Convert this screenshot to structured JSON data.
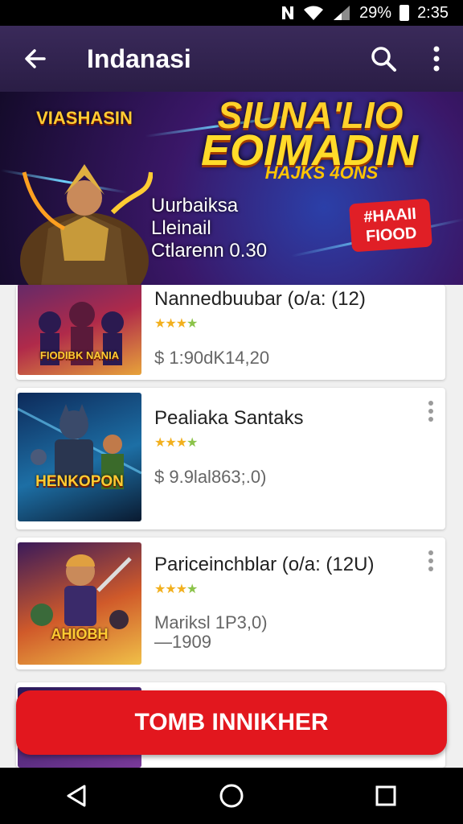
{
  "status_bar": {
    "battery": "29%",
    "time": "2:35",
    "icons": [
      "nfc-icon",
      "wifi-icon",
      "signal-icon",
      "battery-icon"
    ]
  },
  "app_bar": {
    "title": "Indanasi",
    "icons": [
      "back-arrow-icon",
      "search-icon",
      "more-vertical-icon"
    ]
  },
  "banner": {
    "logo_text": "VIASHASIN",
    "headline_1": "SIUNA'LIO",
    "headline_2": "EOIMADIN",
    "subheadline": "HAJKS 4ONS",
    "lines": [
      "Uurbaiksa",
      "Lleinail",
      "Ctlarenn 0.30"
    ],
    "badge": "#HAAII FIOOD"
  },
  "games": [
    {
      "name": "Nannedbuubar (o/a: (12)",
      "rating": 4,
      "price": "$ 1:90dK14,20",
      "thumb_label": "FIODIBK NANIA",
      "thumb_colors": [
        "#3a2a7a",
        "#b02a4a",
        "#e7a33a"
      ]
    },
    {
      "name": "Pealiaka Santaks",
      "rating": 4,
      "price": "$ 9.9lal863;.0)",
      "thumb_label": "HENKOPON",
      "thumb_colors": [
        "#0d2a5a",
        "#1d6fa5",
        "#f0b84a"
      ]
    },
    {
      "name": "Pariceinchblar (o/a: (12U)",
      "rating": 4,
      "price": "Mariksl 1P3,0)\n—1909",
      "thumb_label": "AHIOBH",
      "thumb_colors": [
        "#3a1a5a",
        "#d05a2a",
        "#f0c048"
      ]
    }
  ],
  "cta": {
    "label": "TOMB INNIKHER"
  },
  "nav_bar": {
    "icons": [
      "back-triangle-icon",
      "home-circle-icon",
      "recents-square-icon"
    ]
  },
  "colors": {
    "app_bar": "#2e2050",
    "cta": "#e2171e",
    "star": "#f2b01e"
  }
}
